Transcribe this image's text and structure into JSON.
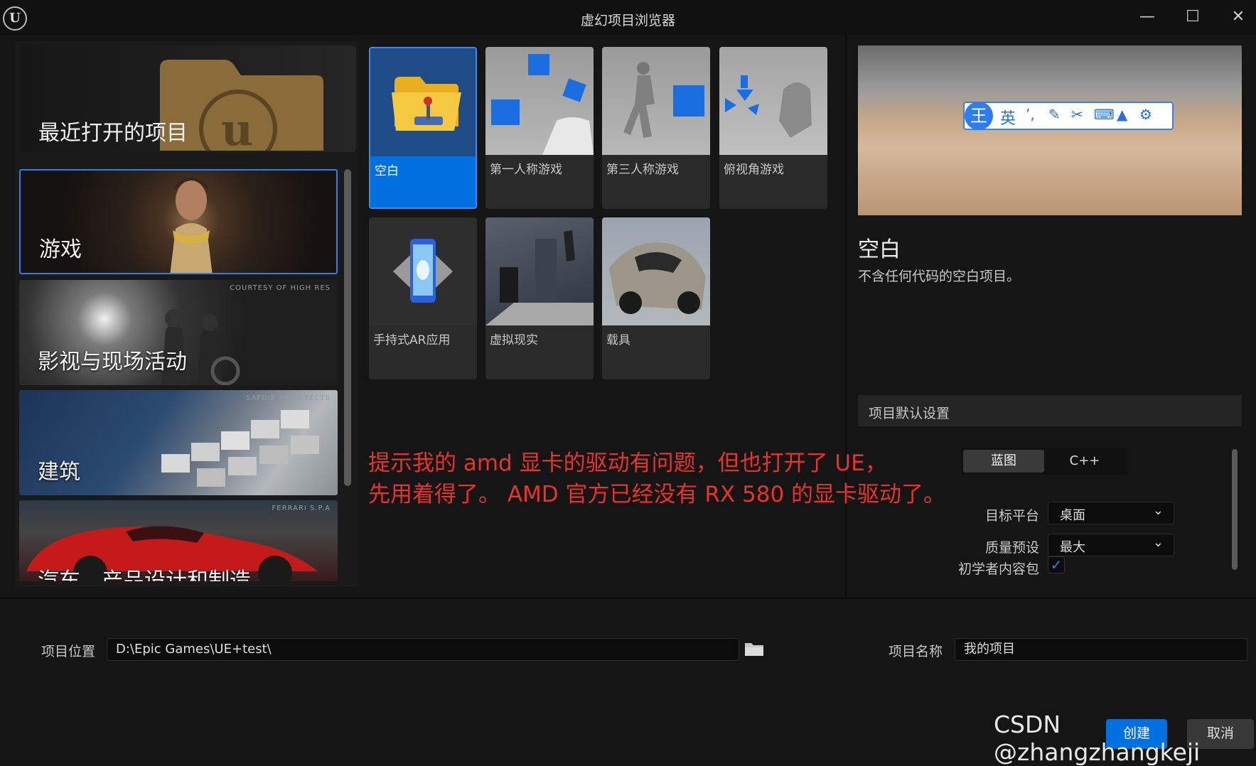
{
  "window": {
    "title": "虚幻项目浏览器"
  },
  "left": {
    "recent_label": "最近打开的项目",
    "categories": [
      {
        "label": "游戏",
        "credit": ""
      },
      {
        "label": "影视与现场活动",
        "credit": "COURTESY OF HIGH RES"
      },
      {
        "label": "建筑",
        "credit": "SAFDIE ARCHITECTS"
      },
      {
        "label": "汽车、产品设计和制造",
        "credit": "FERRARI S.P.A"
      }
    ]
  },
  "templates": [
    {
      "label": "空白",
      "selected": true
    },
    {
      "label": "第一人称游戏"
    },
    {
      "label": "第三人称游戏"
    },
    {
      "label": "俯视角游戏"
    },
    {
      "label": "手持式AR应用"
    },
    {
      "label": "虚拟现实"
    },
    {
      "label": "载具"
    }
  ],
  "ime": {
    "logo": "王",
    "mode": "英"
  },
  "details": {
    "name": "空白",
    "description": "不含任何代码的空白项目。",
    "settings_title": "项目默认设置",
    "lang_options": [
      "蓝图",
      "C++"
    ],
    "target_platform_label": "目标平台",
    "target_platform_value": "桌面",
    "quality_label": "质量预设",
    "quality_value": "最大",
    "starter_label": "初学者内容包",
    "starter_checked": true
  },
  "bottom": {
    "location_label": "项目位置",
    "location_value": "D:\\Epic Games\\UE+test\\",
    "name_label": "项目名称",
    "name_value": "我的项目",
    "create_label": "创建",
    "cancel_label": "取消"
  },
  "annotation": {
    "line1": "提示我的 amd 显卡的驱动有问题，但也打开了 UE，",
    "line2": "先用着得了。 AMD 官方已经没有 RX 580 的显卡驱动了。"
  },
  "watermark": "CSDN @zhangzhangkeji",
  "colors": {
    "accent": "#0070e0",
    "annotation": "#e8322a"
  }
}
